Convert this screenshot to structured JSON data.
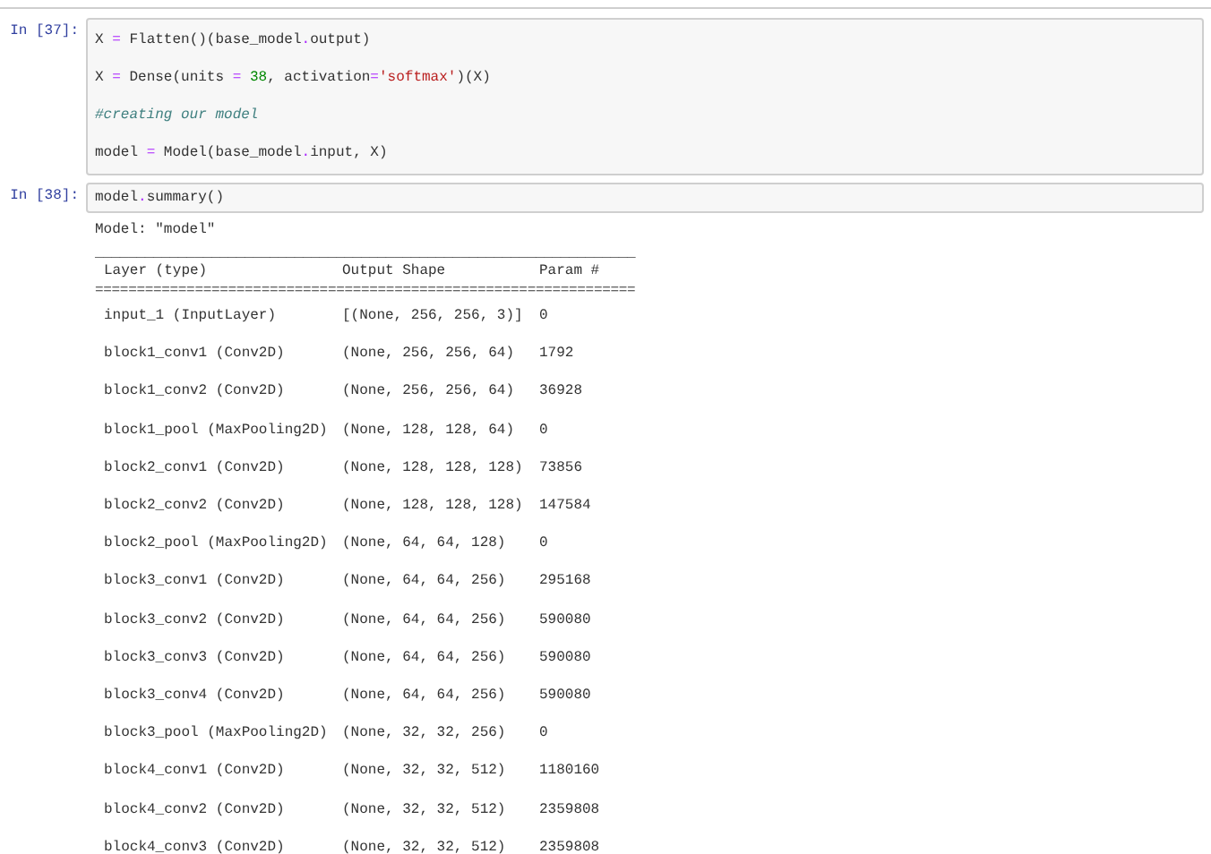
{
  "cells": [
    {
      "prompt": "In [37]:",
      "lines": [
        [
          {
            "kind": "name",
            "text": "X "
          },
          {
            "kind": "op",
            "text": "="
          },
          {
            "kind": "name",
            "text": " Flatten()(base_model"
          },
          {
            "kind": "op",
            "text": "."
          },
          {
            "kind": "name",
            "text": "output)"
          }
        ],
        [
          {
            "kind": "name",
            "text": "X "
          },
          {
            "kind": "op",
            "text": "="
          },
          {
            "kind": "name",
            "text": " Dense(units "
          },
          {
            "kind": "op",
            "text": "="
          },
          {
            "kind": "number",
            "text": " 38"
          },
          {
            "kind": "name",
            "text": ", activation"
          },
          {
            "kind": "op",
            "text": "="
          },
          {
            "kind": "string",
            "text": "'softmax'"
          },
          {
            "kind": "name",
            "text": ")(X)"
          }
        ],
        [
          {
            "kind": "comment",
            "text": "#creating our model"
          }
        ],
        [
          {
            "kind": "name",
            "text": "model "
          },
          {
            "kind": "op",
            "text": "="
          },
          {
            "kind": "name",
            "text": " Model(base_model"
          },
          {
            "kind": "op",
            "text": "."
          },
          {
            "kind": "name",
            "text": "input, X)"
          }
        ]
      ]
    },
    {
      "prompt": "In [38]:",
      "lines": [
        [
          {
            "kind": "name",
            "text": "model"
          },
          {
            "kind": "op",
            "text": "."
          },
          {
            "kind": "name",
            "text": "summary()"
          }
        ]
      ],
      "output": {
        "model_line": "Model: \"model\"",
        "top_rule": "_________________________________________________________________",
        "columns": [
          "Layer (type)",
          "Output Shape",
          "Param #"
        ],
        "header_rule": "=================================================================",
        "rows": [
          [
            "input_1 (InputLayer)",
            "[(None, 256, 256, 3)]",
            "0"
          ],
          [
            "block1_conv1 (Conv2D)",
            "(None, 256, 256, 64)",
            "1792"
          ],
          [
            "block1_conv2 (Conv2D)",
            "(None, 256, 256, 64)",
            "36928"
          ],
          [
            "block1_pool (MaxPooling2D)",
            "(None, 128, 128, 64)",
            "0"
          ],
          [
            "block2_conv1 (Conv2D)",
            "(None, 128, 128, 128)",
            "73856"
          ],
          [
            "block2_conv2 (Conv2D)",
            "(None, 128, 128, 128)",
            "147584"
          ],
          [
            "block2_pool (MaxPooling2D)",
            "(None, 64, 64, 128)",
            "0"
          ],
          [
            "block3_conv1 (Conv2D)",
            "(None, 64, 64, 256)",
            "295168"
          ],
          [
            "block3_conv2 (Conv2D)",
            "(None, 64, 64, 256)",
            "590080"
          ],
          [
            "block3_conv3 (Conv2D)",
            "(None, 64, 64, 256)",
            "590080"
          ],
          [
            "block3_conv4 (Conv2D)",
            "(None, 64, 64, 256)",
            "590080"
          ],
          [
            "block3_pool (MaxPooling2D)",
            "(None, 32, 32, 256)",
            "0"
          ],
          [
            "block4_conv1 (Conv2D)",
            "(None, 32, 32, 512)",
            "1180160"
          ],
          [
            "block4_conv2 (Conv2D)",
            "(None, 32, 32, 512)",
            "2359808"
          ],
          [
            "block4_conv3 (Conv2D)",
            "(None, 32, 32, 512)",
            "2359808"
          ]
        ]
      }
    }
  ]
}
